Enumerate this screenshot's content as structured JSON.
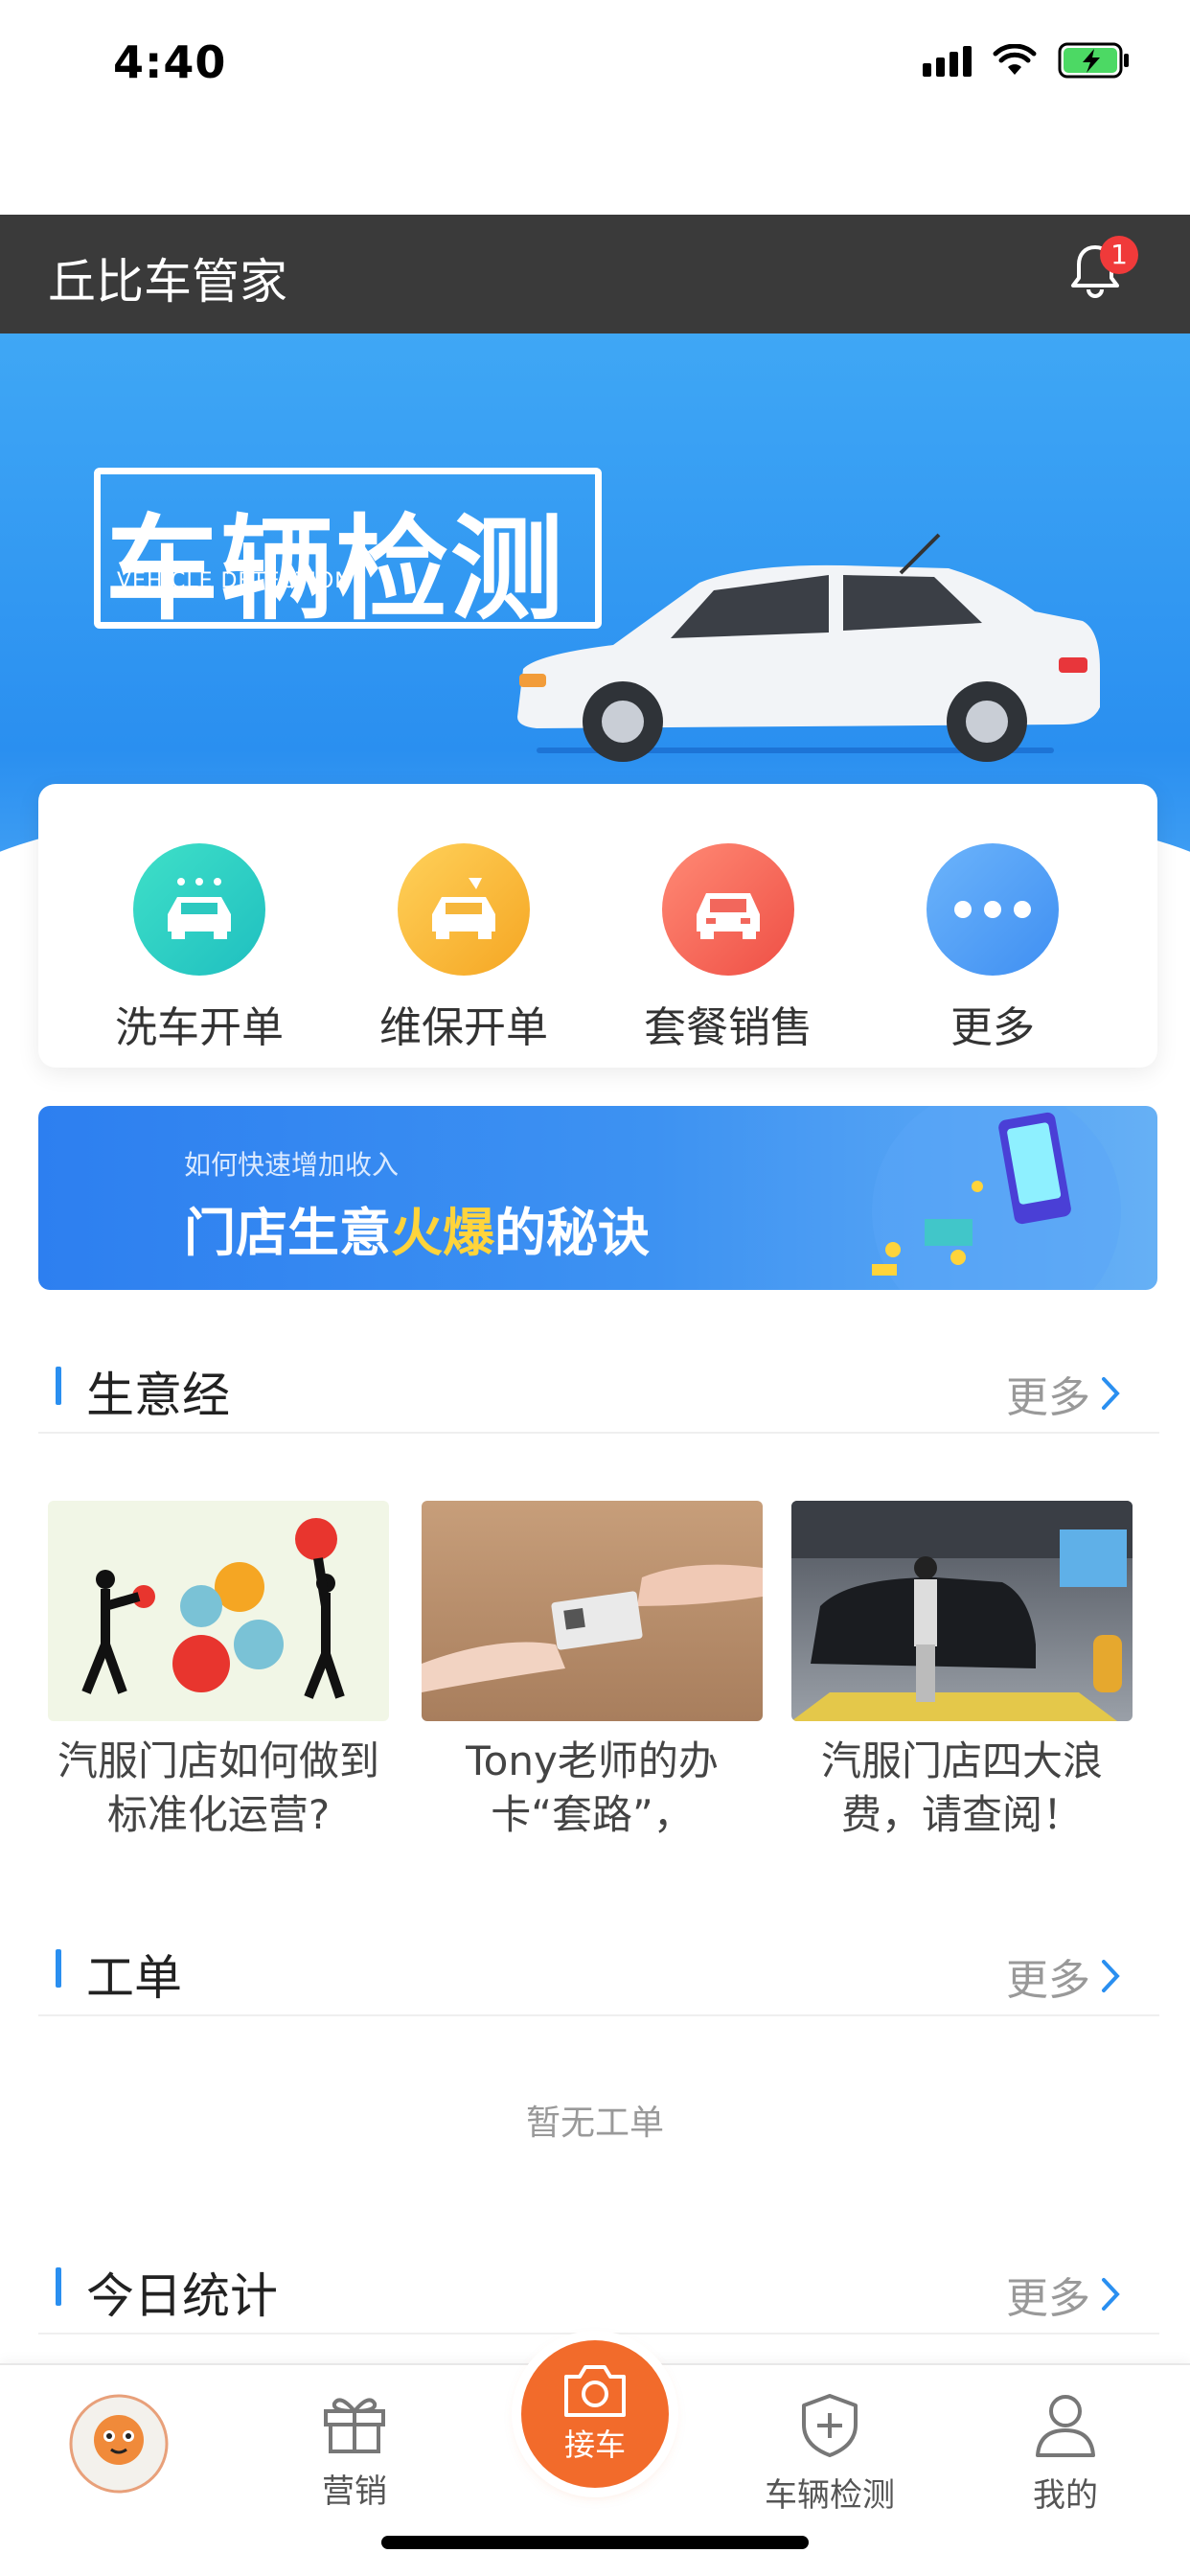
{
  "status_bar": {
    "time": "4:40"
  },
  "header": {
    "title": "丘比车管家",
    "notification_count": "1"
  },
  "banner": {
    "title": "车辆检测",
    "subtitle": "VEHICLE DETECTION"
  },
  "quick_actions": [
    {
      "label": "洗车开单",
      "icon": "car-wash-icon",
      "color": "#2fd3c4"
    },
    {
      "label": "维保开单",
      "icon": "car-repair-icon",
      "color": "#f7b733"
    },
    {
      "label": "套餐销售",
      "icon": "car-package-icon",
      "color": "#f2675c"
    },
    {
      "label": "更多",
      "icon": "more-icon",
      "color": "#4f9ff5"
    }
  ],
  "promo": {
    "subtitle": "如何快速增加收入",
    "title_part1": "门店生意",
    "title_highlight": "火爆",
    "title_part2": "的秘诀"
  },
  "sections": {
    "business": {
      "title": "生意经",
      "more": "更多"
    },
    "work_orders": {
      "title": "工单",
      "more": "更多",
      "empty": "暂无工单"
    },
    "today_stats": {
      "title": "今日统计",
      "more": "更多"
    }
  },
  "articles": [
    {
      "title": "汽服门店如何做到标准化运营?"
    },
    {
      "title": "Tony老师的办卡“套路”，"
    },
    {
      "title": "汽服门店四大浪费，请查阅！"
    }
  ],
  "tab_bar": {
    "items": [
      {
        "label": "",
        "icon": "store-avatar-icon"
      },
      {
        "label": "营销",
        "icon": "gift-icon"
      },
      {
        "label": "接车",
        "icon": "camera-icon"
      },
      {
        "label": "车辆检测",
        "icon": "shield-plus-icon"
      },
      {
        "label": "我的",
        "icon": "user-icon"
      }
    ]
  },
  "colors": {
    "accent": "#2a8ff0",
    "header_bg": "#3a3a3a",
    "center_tab": "#f26b2b",
    "badge": "#f03a3a"
  }
}
